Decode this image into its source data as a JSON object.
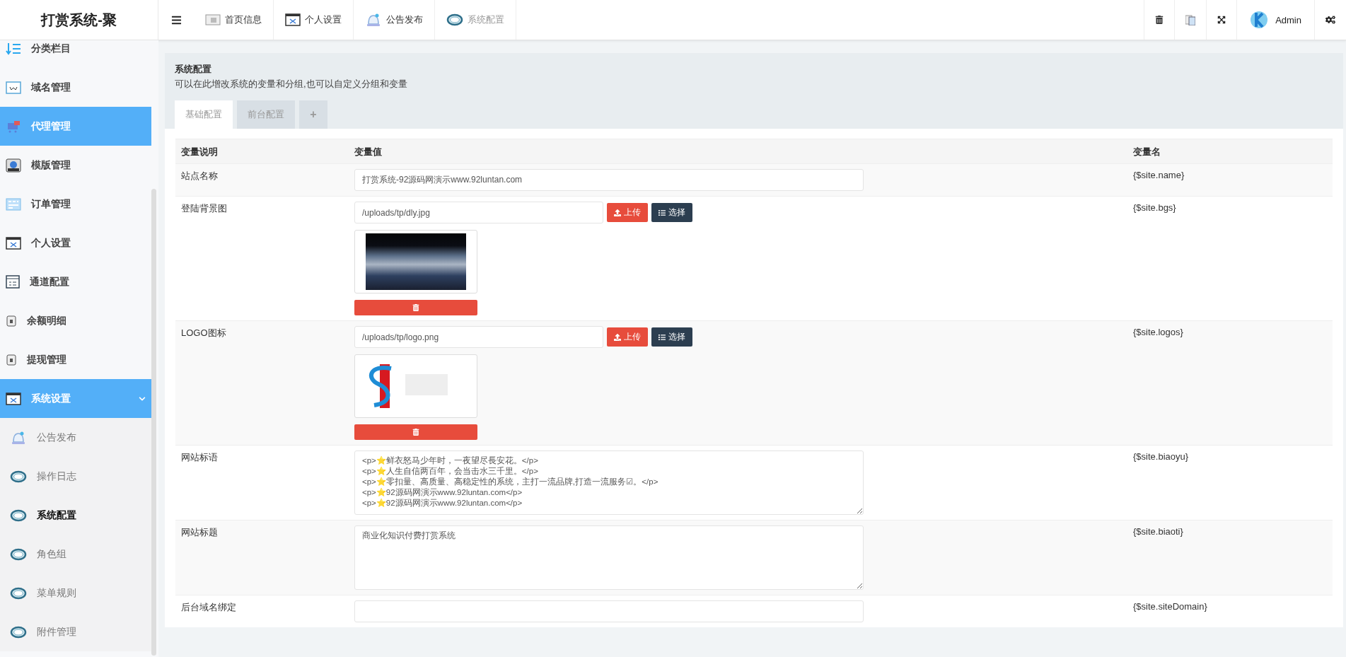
{
  "brand": {
    "title": "打赏系统-聚"
  },
  "nav_tabs": [
    {
      "label": "首页信息",
      "selected": false
    },
    {
      "label": "个人设置",
      "selected": false
    },
    {
      "label": "公告发布",
      "selected": false
    },
    {
      "label": "系统配置",
      "selected": true
    }
  ],
  "user": {
    "name": "Admin"
  },
  "sidebar": {
    "items": [
      {
        "label": "分类栏目",
        "selected": false
      },
      {
        "label": "域名管理",
        "selected": false
      },
      {
        "label": "代理管理",
        "selected": true
      },
      {
        "label": "模版管理",
        "selected": false
      },
      {
        "label": "订单管理",
        "selected": false
      },
      {
        "label": "个人设置",
        "selected": false
      },
      {
        "label": "通道配置",
        "selected": false
      },
      {
        "label": "余额明细",
        "selected": false
      },
      {
        "label": "提现管理",
        "selected": false
      },
      {
        "label": "系统设置",
        "selected": true,
        "expanded": true,
        "children": [
          {
            "label": "公告发布",
            "selected": false
          },
          {
            "label": "操作日志",
            "selected": false
          },
          {
            "label": "系统配置",
            "selected": true
          },
          {
            "label": "角色组",
            "selected": false
          },
          {
            "label": "菜单规则",
            "selected": false
          },
          {
            "label": "附件管理",
            "selected": false
          }
        ]
      }
    ]
  },
  "panel": {
    "title": "系统配置",
    "description": "可以在此增改系统的变量和分组,也可以自定义分组和变量"
  },
  "tabs": [
    {
      "label": "基础配置",
      "selected": true
    },
    {
      "label": "前台配置",
      "selected": false
    }
  ],
  "add_tab": "+",
  "table": {
    "columns": [
      "变量说明",
      "变量值",
      "变量名"
    ],
    "rows": [
      {
        "kind": "text",
        "label": "站点名称",
        "value": "打赏系统-92源码网演示www.92luntan.com",
        "name": "{$site.name}"
      },
      {
        "kind": "image",
        "label": "登陆背景图",
        "value": "/uploads/tp/dly.jpg",
        "upload": "上传",
        "choose": "选择",
        "name": "{$site.bgs}"
      },
      {
        "kind": "image",
        "label": "LOGO图标",
        "value": "/uploads/tp/logo.png",
        "upload": "上传",
        "choose": "选择",
        "name": "{$site.logos}"
      },
      {
        "kind": "textarea",
        "label": "网站标语",
        "lines": [
          "<p>⭐鲜衣怒马少年时，一夜望尽長安花。</p>",
          "<p>⭐人生自信两百年，会当击水三千里。</p>",
          "<p>⭐零扣量、高质量、高稳定性的系统，主打一流品牌,打造一流服务☑。</p>",
          "<p>⭐92源码网演示www.92luntan.com</p>",
          "<p>⭐92源码网演示www.92luntan.com</p>"
        ],
        "name": "{$site.biaoyu}"
      },
      {
        "kind": "textarea",
        "label": "网站标题",
        "lines": [
          "商业化知识付费打赏系统"
        ],
        "name": "{$site.biaoti}"
      },
      {
        "kind": "text",
        "label": "后台域名绑定",
        "value": "",
        "name": "{$site.siteDomain}"
      }
    ]
  }
}
